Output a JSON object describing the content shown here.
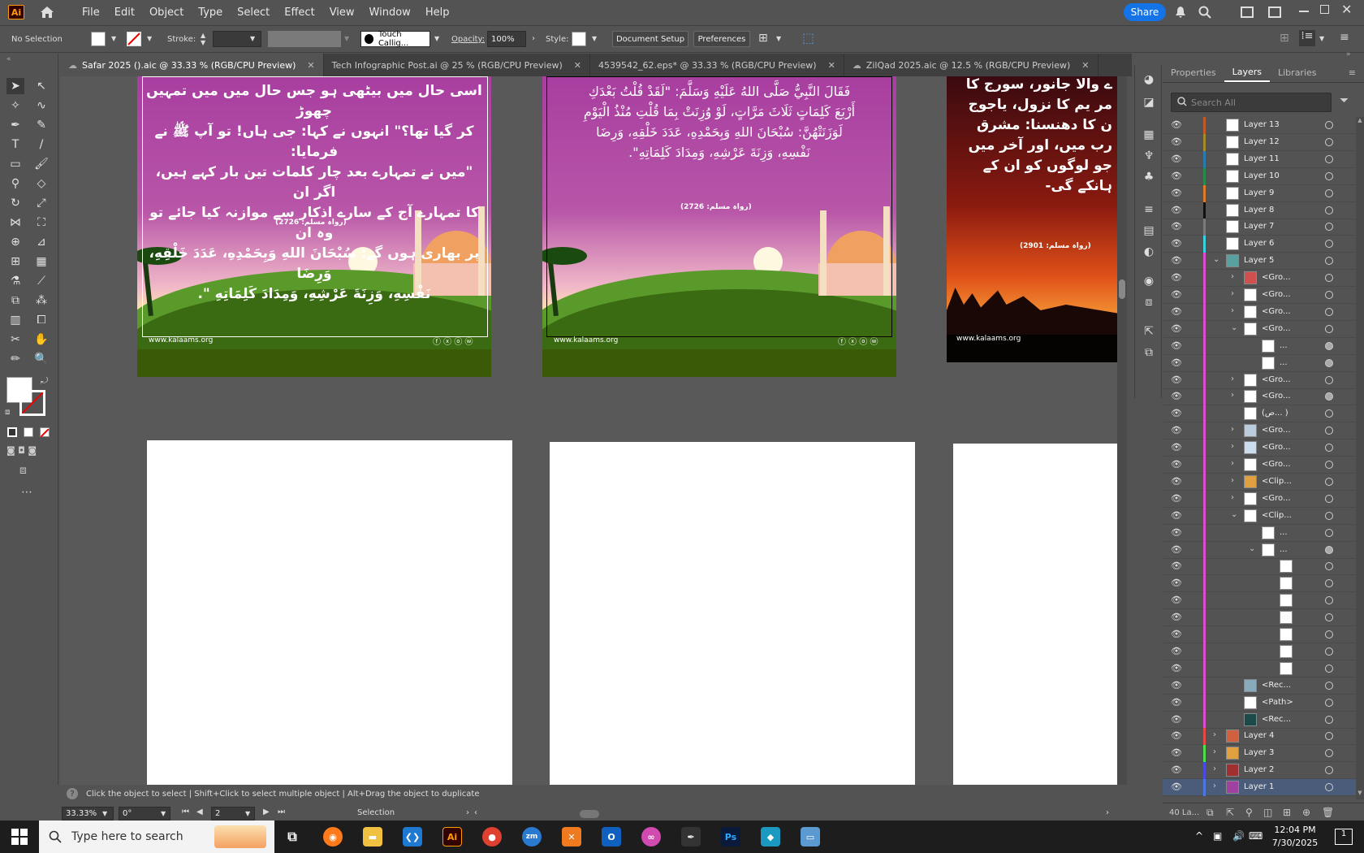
{
  "app": {
    "logo": "Ai"
  },
  "menu": [
    "File",
    "Edit",
    "Object",
    "Type",
    "Select",
    "Effect",
    "View",
    "Window",
    "Help"
  ],
  "share_label": "Share",
  "control": {
    "selection": "No Selection",
    "stroke_label": "Stroke:",
    "brush": "Touch Callig...",
    "opacity_label": "Opacity:",
    "opacity_value": "100%",
    "style_label": "Style:",
    "doc_setup": "Document Setup",
    "preferences": "Preferences"
  },
  "tabs": [
    {
      "label": "Safar 2025 ().aic @ 33.33 % (RGB/CPU Preview)"
    },
    {
      "label": "Tech Infographic Post.ai @ 25 % (RGB/CPU Preview)"
    },
    {
      "label": "4539542_62.eps* @ 33.33 % (RGB/CPU Preview)"
    },
    {
      "label": "ZilQad 2025.aic @ 12.5 % (RGB/CPU Preview)"
    }
  ],
  "artboards": {
    "a1": {
      "lines": [
        "اسی حال میں بیٹھی ہو جس حال میں میں تمہیں چھوڑ",
        "کر گیا تھا؟\" انہوں نے کہا: جی ہاں! تو آپ ﷺ نے فرمایا:",
        "\"میں نے تمہارے بعد چار کلمات تین بار کہے ہیں، اگر ان",
        "کا تمہارے آج کے سارے اذکار سے موازنہ کیا جائے تو وہ ان",
        "پر بھاری ہوں گے: سُبْحَانَ اللهِ وَبِحَمْدِهِ، عَدَدَ خَلْقِهِ، وَرِضَا",
        "نَفْسِهِ، وَزِنَةَ عَرْشِهِ، وَمِدَادَ كَلِمَاتِهِ \"."
      ],
      "ref": "(رواہ مسلم: 2726)",
      "site": "www.kalaams.org"
    },
    "a2": {
      "lines": [
        "فَقَالَ النَّبِيُّ صَلَّى اللهُ عَلَيْهِ وَسَلَّمَ: \"لَقَدْ قُلْتُ بَعْدَكِ",
        "أَرْبَعَ كَلِمَاتٍ ثَلَاثَ مَرَّاتٍ، لَوْ وُزِنَتْ بِمَا قُلْتِ مُنْذُ الْيَوْمِ",
        "لَوَزَنَتْهُنَّ: سُبْحَانَ اللهِ وَبِحَمْدِهِ، عَدَدَ خَلْقِهِ، وَرِضَا",
        "نَفْسِهِ، وَزِنَةَ عَرْشِهِ، وَمِدَادَ كَلِمَاتِهِ\"."
      ],
      "ref": "(رواہ مسلم: 2726)",
      "site": "www.kalaams.org"
    },
    "a3": {
      "lines": [
        "ے والا جانور، سورج کا",
        "مر یم کا نزول، یاجوج",
        "ن کا دھنسنا: مشرق",
        "رب میں، اور آخر میں",
        "جو لوگوں کو ان کے",
        "ہانکے گی-"
      ],
      "ref": "(رواہ مسلم: 2901)",
      "site": "www.kalaams.org"
    }
  },
  "panel": {
    "tabs": [
      "Properties",
      "Layers",
      "Libraries"
    ],
    "search_placeholder": "Search All",
    "layers": [
      {
        "name": "Layer 13",
        "color": "#c05a2a",
        "level": 0,
        "chev": "",
        "thumb": "#fff"
      },
      {
        "name": "Layer 12",
        "color": "#a58a2a",
        "level": 0,
        "chev": "",
        "thumb": "#fff"
      },
      {
        "name": "Layer 11",
        "color": "#2a7ab0",
        "level": 0,
        "chev": "",
        "thumb": "#fff"
      },
      {
        "name": "Layer 10",
        "color": "#2a8a4a",
        "level": 0,
        "chev": "",
        "thumb": "#fff"
      },
      {
        "name": "Layer 9",
        "color": "#e07a2a",
        "level": 0,
        "chev": "",
        "thumb": "#fff"
      },
      {
        "name": "Layer 8",
        "color": "#111111",
        "level": 0,
        "chev": "",
        "thumb": "#fff"
      },
      {
        "name": "Layer 7",
        "color": "#7a7a7a",
        "level": 0,
        "chev": "",
        "thumb": "#fff"
      },
      {
        "name": "Layer 6",
        "color": "#3ad0e0",
        "level": 0,
        "chev": "",
        "thumb": "#fff"
      },
      {
        "name": "Layer 5",
        "color": "#e04ad0",
        "level": 0,
        "chev": "⌄",
        "thumb": "#5aa0a0"
      },
      {
        "name": "<Gro...",
        "color": "#e04ad0",
        "level": 1,
        "chev": "›",
        "thumb": "#d05050"
      },
      {
        "name": "<Gro...",
        "color": "#e04ad0",
        "level": 1,
        "chev": "›",
        "thumb": "#fff"
      },
      {
        "name": "<Gro...",
        "color": "#e04ad0",
        "level": 1,
        "chev": "›",
        "thumb": "#fff"
      },
      {
        "name": "<Gro...",
        "color": "#e04ad0",
        "level": 1,
        "chev": "⌄",
        "thumb": "#fff"
      },
      {
        "name": "...",
        "color": "#e04ad0",
        "level": 2,
        "chev": "",
        "thumb": "#fff"
      },
      {
        "name": "...",
        "color": "#e04ad0",
        "level": 2,
        "chev": "",
        "thumb": "#fff"
      },
      {
        "name": "<Gro...",
        "color": "#e04ad0",
        "level": 1,
        "chev": "›",
        "thumb": "#fff"
      },
      {
        "name": "<Gro...",
        "color": "#e04ad0",
        "level": 1,
        "chev": "›",
        "thumb": "#fff"
      },
      {
        "name": "(ص... )",
        "color": "#e04ad0",
        "level": 1,
        "chev": "",
        "thumb": "#fff"
      },
      {
        "name": "<Gro...",
        "color": "#e04ad0",
        "level": 1,
        "chev": "›",
        "thumb": "#bcd"
      },
      {
        "name": "<Gro...",
        "color": "#e04ad0",
        "level": 1,
        "chev": "›",
        "thumb": "#cde"
      },
      {
        "name": "<Gro...",
        "color": "#e04ad0",
        "level": 1,
        "chev": "›",
        "thumb": "#fff"
      },
      {
        "name": "<Clip...",
        "color": "#e04ad0",
        "level": 1,
        "chev": "›",
        "thumb": "#e0a040"
      },
      {
        "name": "<Gro...",
        "color": "#e04ad0",
        "level": 1,
        "chev": "›",
        "thumb": "#fff"
      },
      {
        "name": "<Clip...",
        "color": "#e04ad0",
        "level": 1,
        "chev": "⌄",
        "thumb": "#fff"
      },
      {
        "name": "...",
        "color": "#e04ad0",
        "level": 2,
        "chev": "",
        "thumb": "#fff"
      },
      {
        "name": "...",
        "color": "#e04ad0",
        "level": 2,
        "chev": "⌄",
        "thumb": "#fff"
      },
      {
        "name": "",
        "color": "#e04ad0",
        "level": 3,
        "chev": "",
        "thumb": "#fff"
      },
      {
        "name": "",
        "color": "#e04ad0",
        "level": 3,
        "chev": "",
        "thumb": "#fff"
      },
      {
        "name": "",
        "color": "#e04ad0",
        "level": 3,
        "chev": "",
        "thumb": "#fff"
      },
      {
        "name": "",
        "color": "#e04ad0",
        "level": 3,
        "chev": "",
        "thumb": "#fff"
      },
      {
        "name": "",
        "color": "#e04ad0",
        "level": 3,
        "chev": "",
        "thumb": "#fff"
      },
      {
        "name": "",
        "color": "#e04ad0",
        "level": 3,
        "chev": "",
        "thumb": "#fff"
      },
      {
        "name": "",
        "color": "#e04ad0",
        "level": 3,
        "chev": "",
        "thumb": "#fff"
      },
      {
        "name": "<Rec...",
        "color": "#e04ad0",
        "level": 1,
        "chev": "",
        "thumb": "#8ab"
      },
      {
        "name": "<Path>",
        "color": "#e04ad0",
        "level": 1,
        "chev": "",
        "thumb": "#fff"
      },
      {
        "name": "<Rec...",
        "color": "#e04ad0",
        "level": 1,
        "chev": "",
        "thumb": "#1a4a4a"
      },
      {
        "name": "Layer 4",
        "color": "#e04a4a",
        "level": 0,
        "chev": "›",
        "thumb": "#d06040"
      },
      {
        "name": "Layer 3",
        "color": "#4ae04a",
        "level": 0,
        "chev": "›",
        "thumb": "#e0a040"
      },
      {
        "name": "Layer 2",
        "color": "#4a4ae0",
        "level": 0,
        "chev": "›",
        "thumb": "#a03030"
      },
      {
        "name": "Layer 1",
        "color": "#4a7ae0",
        "level": 0,
        "chev": "›",
        "thumb": "#a040a0",
        "selected": true
      }
    ],
    "footer_count": "40 La..."
  },
  "hint": {
    "text": "Click the object to select  |  Shift+Click to select multiple object  |  Alt+Drag the object to duplicate"
  },
  "status": {
    "zoom": "33.33%",
    "rotate": "0°",
    "artboard": "2",
    "tool": "Selection"
  },
  "taskbar": {
    "search": "Type here to search",
    "time": "12:04 PM",
    "date": "7/30/2025",
    "notif": "1"
  }
}
